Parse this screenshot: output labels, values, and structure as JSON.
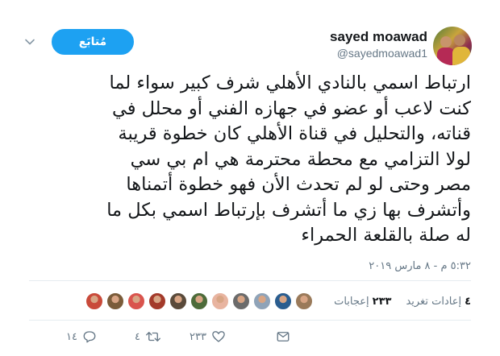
{
  "user": {
    "name": "sayed moawad",
    "handle": "@sayedmoawad1"
  },
  "follow_label": "مُتابَع",
  "tweet": {
    "lines": [
      "ارتباط اسمي بالنادي الأهلي شرف كبير سواء لما",
      "كنت لاعب أو عضو في جهازه الفني أو محلل في",
      "قناته، والتحليل في قناة الأهلي كان خطوة قريبة",
      "لولا التزامي مع محطة محترمة هي ام بي سي",
      "مصر وحتى لو لم تحدث الأن فهو خطوة أتمناها",
      "وأتشرف بها زي ما أتشرف بإرتباط اسمي بكل ما",
      "له صلة بالقلعة الحمراء"
    ],
    "timestamp": "٥:٣٢ م - ٨ مارس ٢٠١٩"
  },
  "stats": {
    "retweets_count": "٤",
    "retweets_label": "إعادات تغريد",
    "likes_count": "٢٣٣",
    "likes_label": "إعجابات"
  },
  "likers": [
    "#c94a3a",
    "#7a5c3a",
    "#d9544d",
    "#a33a2a",
    "#5a4a3a",
    "#4d6b3a",
    "#e8b4a0",
    "#6b6b6b",
    "#8fa3b8",
    "#2a5d8f",
    "#9a7a5a"
  ],
  "actions": {
    "reply_count": "١٤",
    "retweet_count": "٤",
    "like_count": "٢٣٣"
  },
  "colors": {
    "accent": "#1da1f2",
    "text": "#14171a",
    "secondary": "#657786",
    "divider": "#e6ecf0"
  }
}
